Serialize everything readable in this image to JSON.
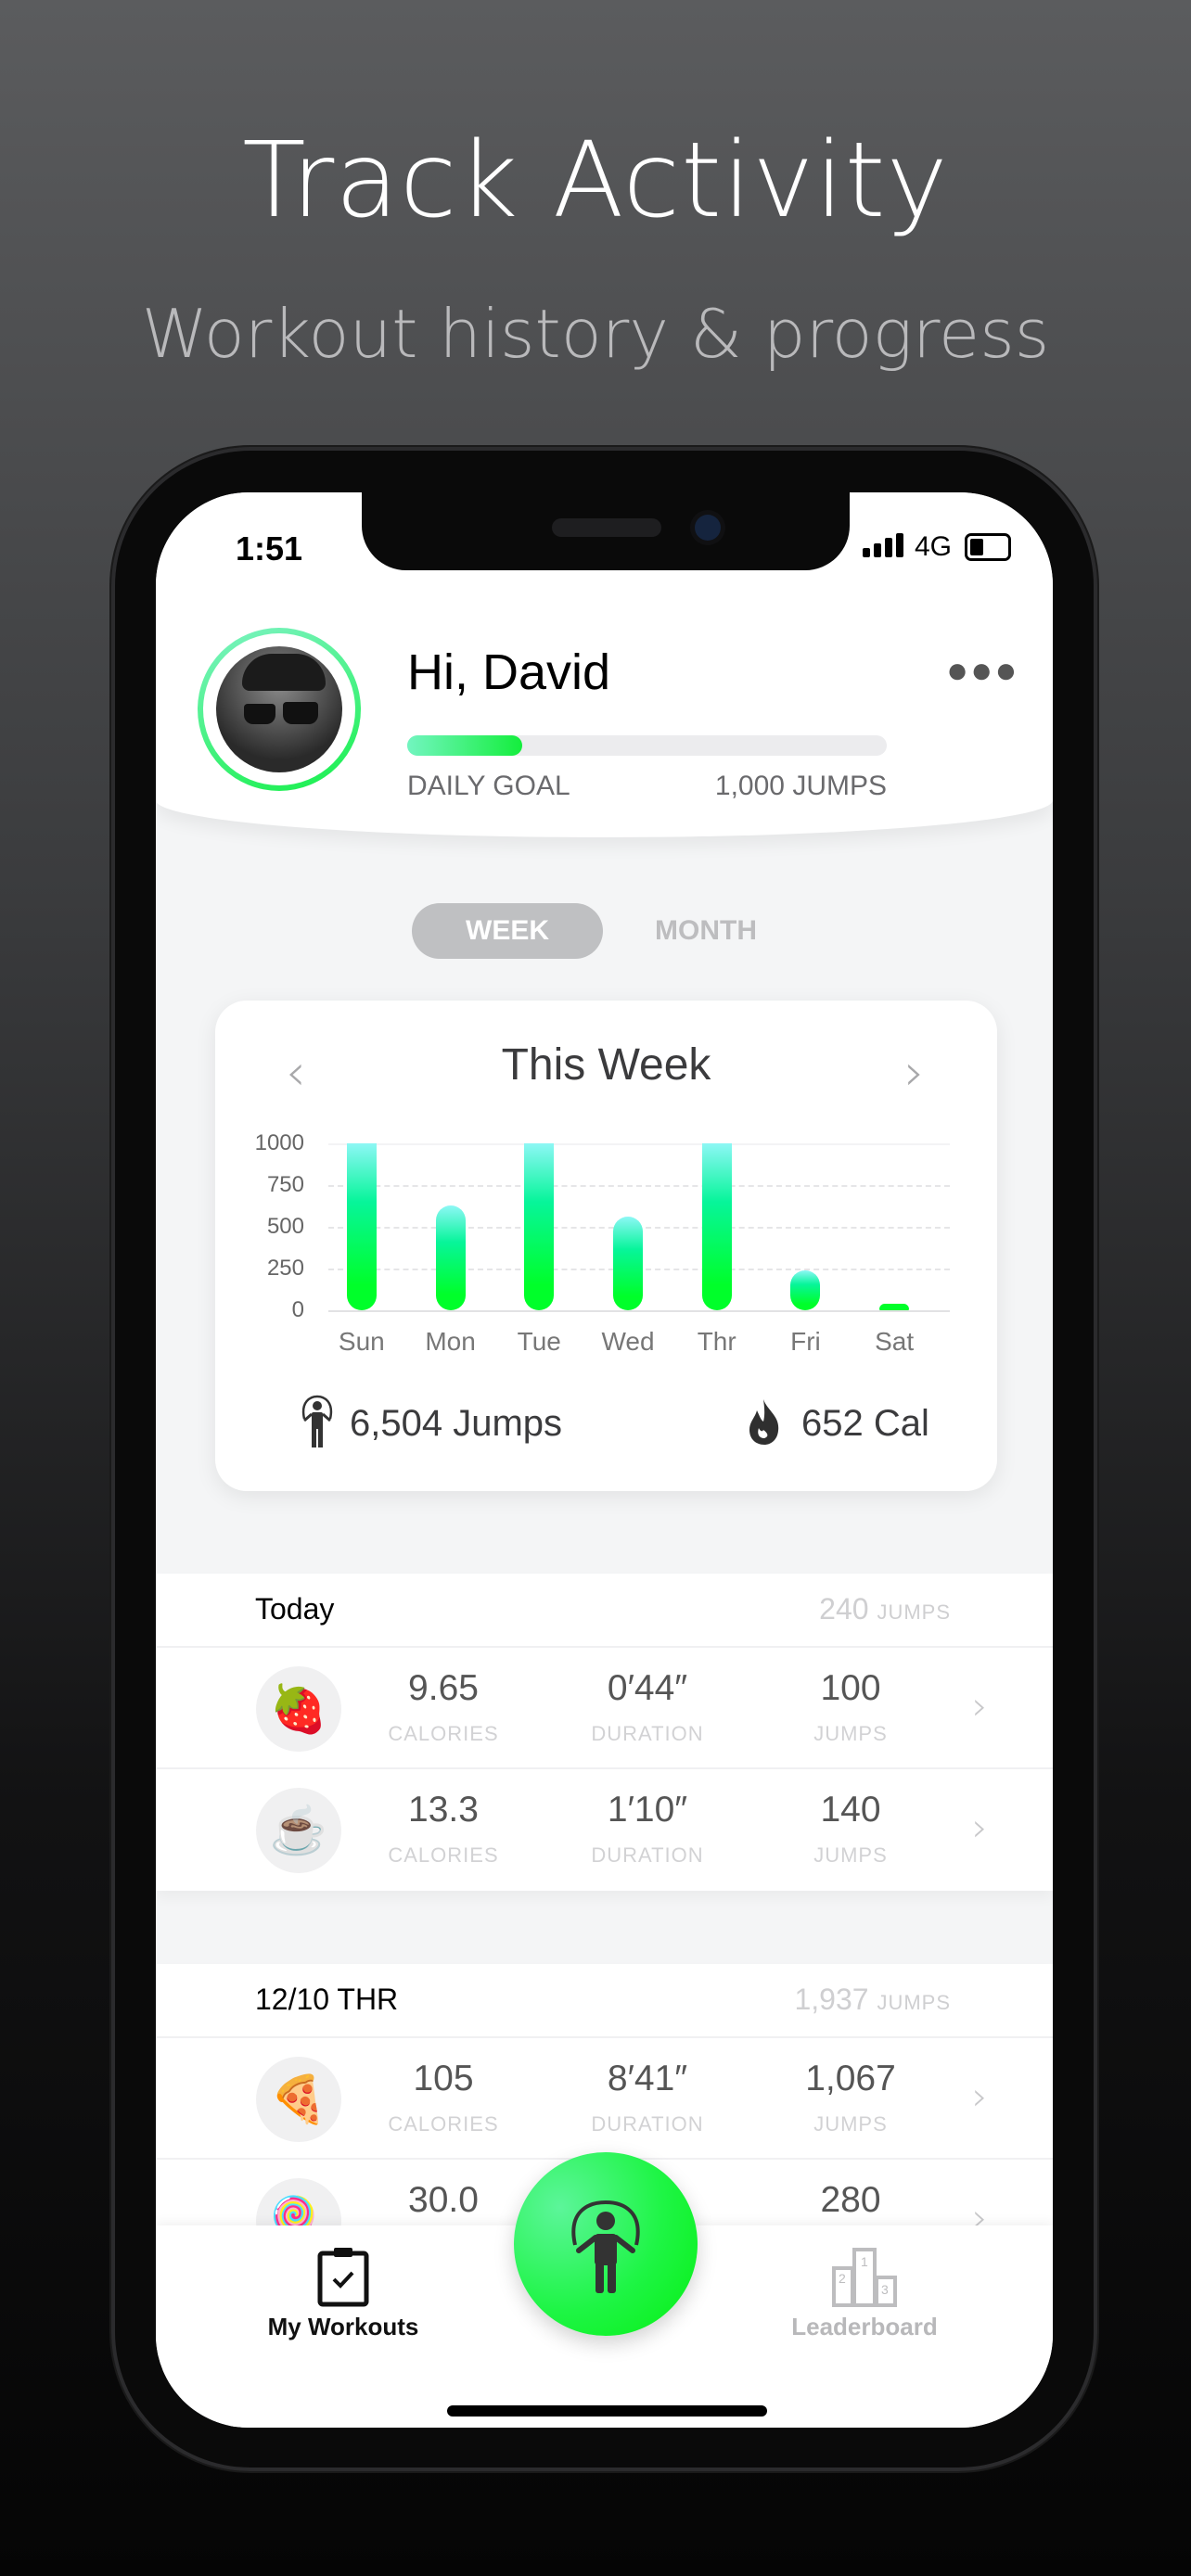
{
  "hero": {
    "title": "Track Activity",
    "subtitle": "Workout history & progress"
  },
  "status_bar": {
    "time": "1:51",
    "network": "4G",
    "battery_level": 0.35
  },
  "header": {
    "greeting": "Hi, David",
    "goal_label": "DAILY GOAL",
    "goal_value": "1,000 JUMPS",
    "goal_progress": 0.24,
    "more_icon": "more-horizontal-icon"
  },
  "period_toggle": {
    "options": [
      "WEEK",
      "MONTH"
    ],
    "selected": "WEEK"
  },
  "weekly_card": {
    "title": "This Week",
    "total_jumps": "6,504 Jumps",
    "total_calories": "652 Cal",
    "jumps_icon": "jump-rope-icon",
    "calories_icon": "flame-icon"
  },
  "chart_data": {
    "type": "bar",
    "categories": [
      "Sun",
      "Mon",
      "Tue",
      "Wed",
      "Thr",
      "Fri",
      "Sat"
    ],
    "values": [
      1000,
      630,
      1000,
      560,
      1000,
      240,
      40
    ],
    "yticks": [
      0,
      250,
      500,
      750,
      1000
    ],
    "ylim": [
      0,
      1000
    ],
    "grid": true,
    "colors": {
      "bar_top": "#8df7f5",
      "bar_bottom": "#00ff2a"
    }
  },
  "sections": [
    {
      "title": "Today",
      "total_value": "240",
      "total_unit": "JUMPS",
      "rows": [
        {
          "emoji": "🍓",
          "calories": "9.65",
          "duration": "0′44″",
          "jumps": "100"
        },
        {
          "emoji": "☕",
          "calories": "13.3",
          "duration": "1′10″",
          "jumps": "140"
        }
      ]
    },
    {
      "title": "12/10  THR",
      "total_value": "1,937",
      "total_unit": "JUMPS",
      "rows": [
        {
          "emoji": "🍕",
          "calories": "105",
          "duration": "8′41″",
          "jumps": "1,067"
        },
        {
          "emoji": "🍭",
          "calories": "30.0",
          "duration": "",
          "jumps": "280"
        }
      ]
    }
  ],
  "labels": {
    "calories": "CALORIES",
    "duration": "DURATION",
    "jumps": "JUMPS"
  },
  "tabbar": {
    "tabs": [
      {
        "label": "My Workouts",
        "icon": "clipboard-check-icon",
        "active": true
      },
      {
        "label": "Leaderboard",
        "icon": "podium-icon",
        "active": false
      }
    ],
    "fab_icon": "jump-rope-icon"
  },
  "colors": {
    "accent": "#14ee3c",
    "accent_light": "#72f5c0"
  }
}
